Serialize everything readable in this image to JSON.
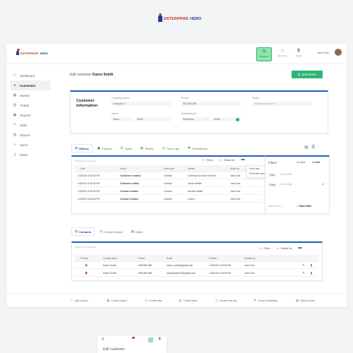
{
  "brand": {
    "name_a": "ENTERPRISE",
    "name_b": "HERO"
  },
  "topbar": {
    "checkin": "Check in",
    "set_home": "Set home",
    "timers": "Timers",
    "user_name": "John Doe"
  },
  "sidebar": {
    "items": [
      {
        "label": "Dashboard",
        "icon": "dashboard-icon"
      },
      {
        "label": "Customers",
        "icon": "customers-icon"
      },
      {
        "label": "Boards",
        "icon": "boards-icon"
      },
      {
        "label": "Tickets",
        "icon": "tickets-icon"
      },
      {
        "label": "Projects",
        "icon": "projects-icon"
      },
      {
        "label": "Skills",
        "icon": "skills-icon"
      },
      {
        "label": "Reports",
        "icon": "reports-icon"
      },
      {
        "label": "Users",
        "icon": "users-icon"
      },
      {
        "label": "Roles",
        "icon": "roles-icon"
      }
    ]
  },
  "header": {
    "prefix": "Edit customer",
    "customer": "Karen Smith",
    "start_timer": "Start timer"
  },
  "customer_info": {
    "title_1": "Customer",
    "title_2": "information",
    "company_label": "Company name",
    "company_value": "Company 1",
    "phone_label": "Phone",
    "phone_value": "504-555-555",
    "email_label": "Email",
    "email_placeholder": "mail@example.com",
    "name_label": "Name",
    "first_name": "Karen",
    "last_name": "Smith",
    "subsidiary_label": "Subsidiary of",
    "subsidiary_value": "Subsidiary",
    "status_value": "Active"
  },
  "history": {
    "tabs": [
      "History",
      "Projects",
      "Tasks",
      "Tickets",
      "Time Logs",
      "Subsidiaries"
    ],
    "showing": "Showing 1 of 5 results",
    "filters": "Filters",
    "reload": "Reload list",
    "menu": [
      "Show tabs",
      "Show/hide columns"
    ],
    "columns": [
      "Date",
      "Action",
      "Event type",
      "Details",
      "Action by"
    ],
    "rows": [
      {
        "date": "1/3/2019 4:26:36 PM",
        "action": "Customer created",
        "type": "Contact",
        "details": "Lorem ipsum dolor sit ame...",
        "by": "John Doe"
      },
      {
        "date": "1/3/2019 4:26:36 PM",
        "action": "Customer edited",
        "type": "Contact",
        "details": "Some details",
        "by": "John Doe"
      },
      {
        "date": "1/3/2019 4:26:36 PM",
        "action": "Contact created",
        "type": "Contact",
        "details": "Another detail",
        "by": "John Doe"
      },
      {
        "date": "1/3/2019 4:26:36 PM",
        "action": "Contact created",
        "type": "Contact",
        "details": "Lorem",
        "by": "John Doe"
      }
    ]
  },
  "filters_panel": {
    "title": "Filters",
    "clear": "Clear",
    "add": "Add",
    "field_1": "User",
    "field_1_value": "Comments",
    "field_2": "Date",
    "field_2_value": "Date range",
    "saved": "Saved filter",
    "save": "Save filter"
  },
  "contacts": {
    "tabs": [
      "Contacts",
      "Contact history",
      "Notes"
    ],
    "showing": "Showing 1 of 5 results",
    "filters": "Filters",
    "reload": "Reload list",
    "columns": [
      "Primary",
      "Contact name",
      "Phone",
      "Email",
      "Created",
      "Created by"
    ],
    "rows": [
      {
        "name": "Karen Smith",
        "phone": "555-555-555",
        "email": "karen_smith@gmail.com",
        "created": "1/3/2019 4:26:36 PM",
        "by": "John Doe"
      },
      {
        "name": "Karen Smith",
        "phone": "555-555-555",
        "email": "karensmith123@gmail.com",
        "created": "1/3/2019 4:26:36 PM",
        "by": "John Doe"
      }
    ]
  },
  "bottom_actions": [
    "Add contact",
    "Create project",
    "Create task",
    "Create ticket",
    "Create time log",
    "Create subsidiary",
    "Add to board"
  ],
  "mobile": {
    "title": "Edit customer"
  },
  "colors": {
    "brand_red": "#c0392b",
    "brand_blue": "#1f3f8f",
    "accent_green": "#2bb673"
  }
}
